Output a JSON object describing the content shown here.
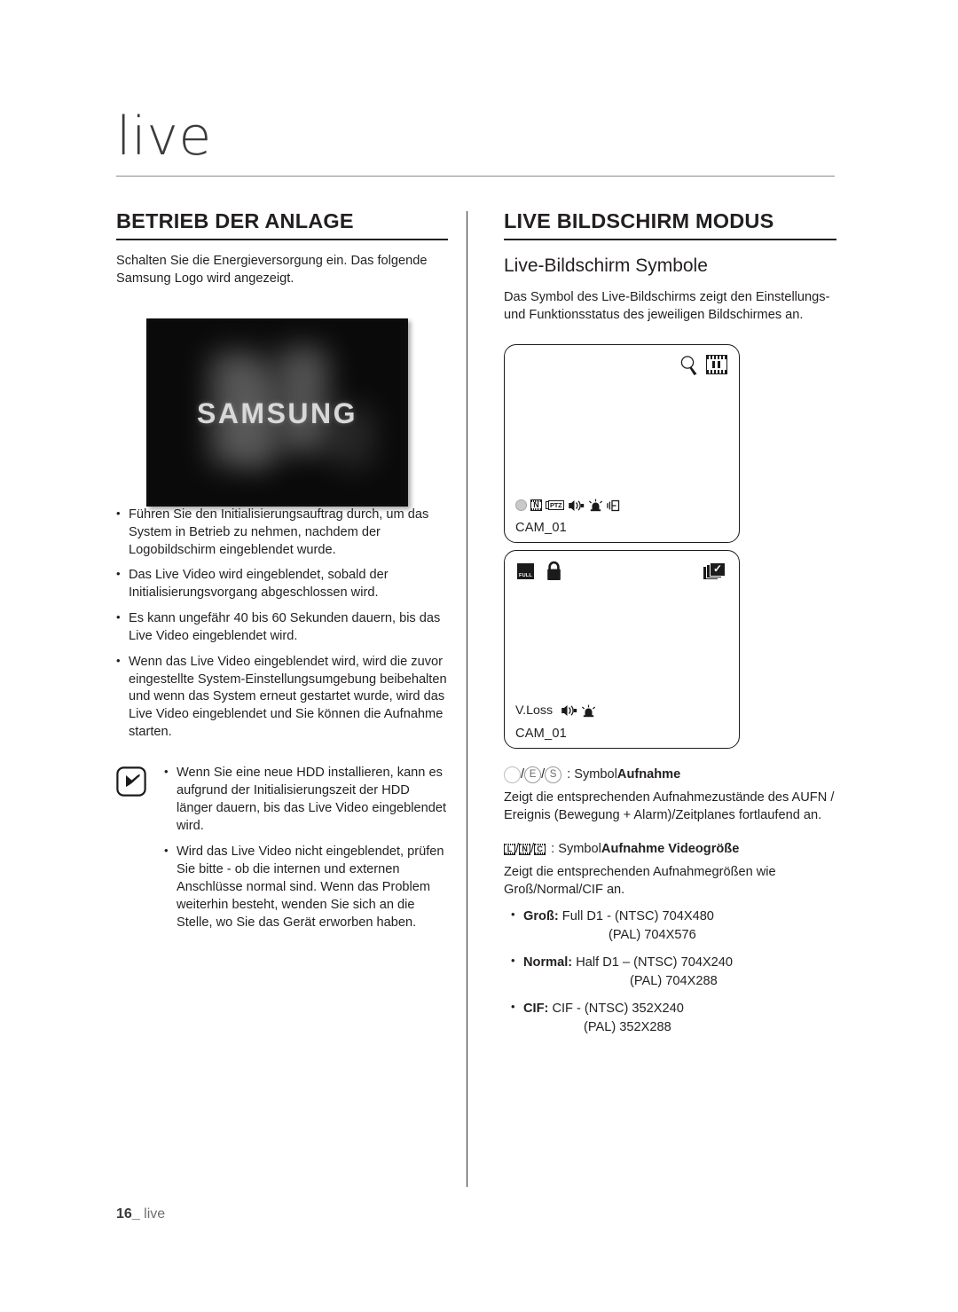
{
  "chapter": {
    "title": "live"
  },
  "left": {
    "section_title": "BETRIEB DER ANLAGE",
    "intro": "Schalten Sie die Energieversorgung ein. Das folgende Samsung Logo wird angezeigt.",
    "photo": {
      "wordmark": "SAMSUNG"
    },
    "bullets": [
      "Führen Sie den Initialisierungsauftrag durch, um das System in Betrieb zu nehmen, nachdem der Logobildschirm eingeblendet wurde.",
      "Das Live Video wird eingeblendet, sobald der Initialisierungsvorgang abgeschlossen wird.",
      "Es kann ungefähr 40 bis 60 Sekunden dauern, bis das Live Video eingeblendet wird.",
      "Wenn das Live Video eingeblendet wird, wird die zuvor eingestellte System-Einstellungsumgebung beibehalten und wenn das System erneut gestartet wurde, wird das Live Video eingeblendet und Sie können die Aufnahme starten."
    ],
    "note": {
      "icon": "note-pen-icon",
      "bullets": [
        "Wenn Sie eine neue HDD installieren, kann es aufgrund der Initialisierungszeit der HDD länger dauern, bis das Live Video eingeblendet wird.",
        "Wird das Live Video nicht eingeblendet, prüfen Sie bitte - ob die internen und externen Anschlüsse normal sind. Wenn das Problem weiterhin besteht, wenden Sie sich an die Stelle, wo Sie das Gerät erworben haben."
      ]
    }
  },
  "right": {
    "section_title": "LIVE BILDSCHIRM MODUS",
    "subsection_title": "Live-Bildschirm Symbole",
    "intro": "Das Symbol des Live-Bildschirms zeigt den Einstellungs- und Funktionsstatus des jeweiligen Bildschirmes an.",
    "screens": [
      {
        "name": "screen-mockup-1",
        "label": "CAM_01",
        "top_right_icons": [
          "zoom-magnifier-icon",
          "film-strip-icon"
        ],
        "status_icons": [
          "record-circle-icon",
          "video-size-normal-icon",
          "ptz-icon",
          "audio-speaker-icon",
          "alarm-siren-icon",
          "motion-sensor-icon"
        ]
      },
      {
        "name": "screen-mockup-2",
        "label": "CAM_01",
        "status_text": "V.Loss",
        "top_left_icons": [
          "full-screen-icon",
          "lock-padlock-icon"
        ],
        "top_right_icons": [
          "sequence-stack-check-icon"
        ],
        "status_icons": [
          "audio-speaker-icon",
          "alarm-siren-icon"
        ]
      }
    ],
    "legend": [
      {
        "icons": [
          "record-circle-empty-icon",
          "record-event-icon",
          "record-schedule-icon"
        ],
        "icon_letters": [
          "",
          "E",
          "S"
        ],
        "separator": "/",
        "prefix": ": Symbol ",
        "term": "Aufnahme",
        "description": "Zeigt die entsprechenden Aufnahmezustände des AUFN / Ereignis (Bewegung + Alarm)/Zeitplanes fortlaufend an."
      },
      {
        "icons": [
          "video-size-large-icon",
          "video-size-normal-icon",
          "video-size-cif-icon"
        ],
        "icon_letters": [
          "L",
          "N",
          "C"
        ],
        "separator": "/",
        "prefix": ": Symbol ",
        "term": "Aufnahme Videogröße",
        "description": "Zeigt die entsprechenden Aufnahmegrößen wie Groß/Normal/CIF an."
      }
    ],
    "resolutions": [
      {
        "name": "Groß:",
        "line1": "Full D1 - (NTSC) 704X480",
        "line2": "(PAL) 704X576",
        "indent": "wide"
      },
      {
        "name": "Normal:",
        "line1": "Half D1 – (NTSC) 704X240",
        "line2": "(PAL) 704X288",
        "indent": "wider"
      },
      {
        "name": "CIF:",
        "line1": "CIF - (NTSC) 352X240",
        "line2": "(PAL) 352X288",
        "indent": "narrow"
      }
    ]
  },
  "footer": {
    "page": "16_",
    "label": "live"
  }
}
